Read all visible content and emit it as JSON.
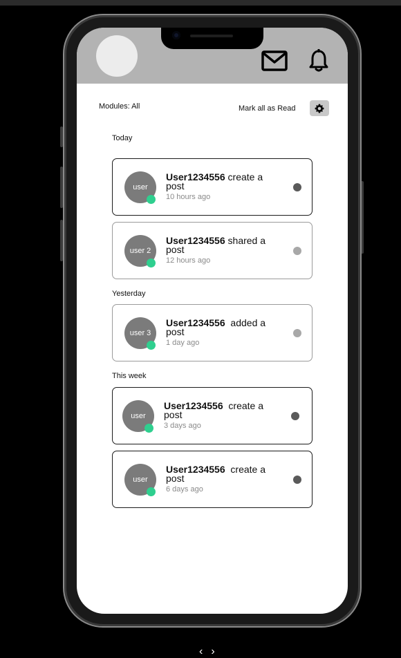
{
  "header": {
    "mail_icon": "mail-icon",
    "bell_icon": "bell-icon"
  },
  "toolbar": {
    "modules_label": "Modules: All",
    "mark_all_read_label": "Mark all as Read",
    "settings_icon": "gear-icon"
  },
  "sections": [
    {
      "label": "Today"
    },
    {
      "label": "Yesterday"
    },
    {
      "label": "This week"
    }
  ],
  "notifications": [
    {
      "avatar_label": "user",
      "username": "User1234556",
      "action_line1": " create a",
      "action_line2": "post",
      "time": "10 hours ago",
      "read": false
    },
    {
      "avatar_label": "user 2",
      "username": "User1234556",
      "action_line1": " shared a",
      "action_line2": "post",
      "time": "12 hours ago",
      "read": true
    },
    {
      "avatar_label": "user 3",
      "username": "User1234556",
      "action_line1": "  added a",
      "action_line2": "post",
      "time": "1 day ago",
      "read": true
    },
    {
      "avatar_label": "user",
      "username": "User1234556",
      "action_line1": "  create a",
      "action_line2": "post",
      "time": "3 days ago",
      "read": false
    },
    {
      "avatar_label": "user",
      "username": "User1234556",
      "action_line1": "  create a",
      "action_line2": "post",
      "time": "6 days ago",
      "read": false
    }
  ],
  "colors": {
    "online": "#2fcf8f",
    "unread_dot": "#5a5a5a",
    "read_dot": "#a8a8a8"
  },
  "pager": {
    "prev": "‹",
    "next": "›"
  }
}
